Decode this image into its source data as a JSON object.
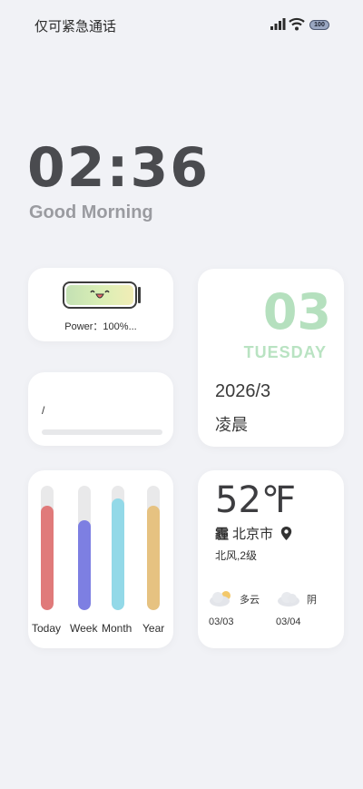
{
  "status_bar": {
    "carrier": "仅可紧急通话",
    "battery": "100"
  },
  "clock": {
    "time": "02:36",
    "greeting": "Good Morning"
  },
  "power_card": {
    "label": "Power：100%...",
    "level": 1.0
  },
  "progress_card": {
    "label": "/"
  },
  "date_card": {
    "day": "03",
    "weekday": "TUESDAY",
    "year_month": "2026/3",
    "period": "凌晨"
  },
  "progress_bars": [
    {
      "label": "Today",
      "fraction": 0.84,
      "color": "#e07a7a"
    },
    {
      "label": "Week",
      "fraction": 0.72,
      "color": "#7d7fe2"
    },
    {
      "label": "Month",
      "fraction": 0.9,
      "color": "#93d9e8"
    },
    {
      "label": "Year",
      "fraction": 0.84,
      "color": "#e6c281"
    }
  ],
  "weather": {
    "temperature": "52℉",
    "icon": "haze-icon",
    "city": "北京市",
    "wind": "北风,2级",
    "forecast": [
      {
        "condition": "多云",
        "date": "03/03",
        "icon": "partly-cloudy-icon"
      },
      {
        "condition": "阴",
        "date": "03/04",
        "icon": "cloudy-icon"
      }
    ]
  }
}
